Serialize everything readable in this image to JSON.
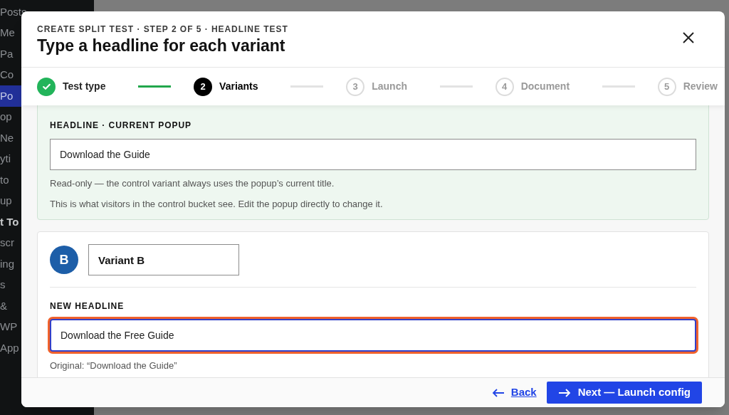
{
  "sidebar": {
    "items": [
      {
        "label": "Posts",
        "selected": false,
        "bold": false
      },
      {
        "label": "Me",
        "selected": false,
        "bold": false
      },
      {
        "label": "Pa",
        "selected": false,
        "bold": false
      },
      {
        "label": "Co",
        "selected": false,
        "bold": false
      },
      {
        "label": "Po",
        "selected": true,
        "bold": false
      },
      {
        "label": "op",
        "selected": false,
        "bold": false
      },
      {
        "label": "Ne",
        "selected": false,
        "bold": false
      },
      {
        "label": "yti",
        "selected": false,
        "bold": false
      },
      {
        "label": "to",
        "selected": false,
        "bold": false
      },
      {
        "label": "up",
        "selected": false,
        "bold": false
      },
      {
        "label": "t To",
        "selected": false,
        "bold": true
      },
      {
        "label": "scr",
        "selected": false,
        "bold": false
      },
      {
        "label": "ing",
        "selected": false,
        "bold": false
      },
      {
        "label": "s",
        "selected": false,
        "bold": false
      },
      {
        "label": "&",
        "selected": false,
        "bold": false
      },
      {
        "label": "WP",
        "selected": false,
        "bold": false
      },
      {
        "label": "App",
        "selected": false,
        "bold": false
      }
    ]
  },
  "modal": {
    "eyebrow": "CREATE SPLIT TEST · STEP 2 OF 5 · HEADLINE TEST",
    "title": "Type a headline for each variant",
    "steps": [
      {
        "label": "Test type",
        "done": true,
        "current": false
      },
      {
        "number": "2",
        "label": "Variants",
        "done": false,
        "current": true
      },
      {
        "number": "3",
        "label": "Launch",
        "done": false,
        "current": false
      },
      {
        "number": "4",
        "label": "Document",
        "done": false,
        "current": false
      },
      {
        "number": "5",
        "label": "Review",
        "done": false,
        "current": false
      }
    ],
    "control": {
      "label": "HEADLINE · CURRENT POPUP",
      "value": "Download the Guide",
      "notes": [
        "Read-only — the control variant always uses the popup’s current title.",
        "This is what visitors in the control bucket see. Edit the popup directly to change it."
      ]
    },
    "variant": {
      "avatar": "B",
      "name": "Variant B",
      "label": "NEW HEADLINE",
      "value": "Download the Free Guide",
      "focused": true,
      "note": "Original: “Download the Guide”"
    },
    "footer": {
      "back": "Back",
      "next": "Next — Launch config"
    }
  }
}
